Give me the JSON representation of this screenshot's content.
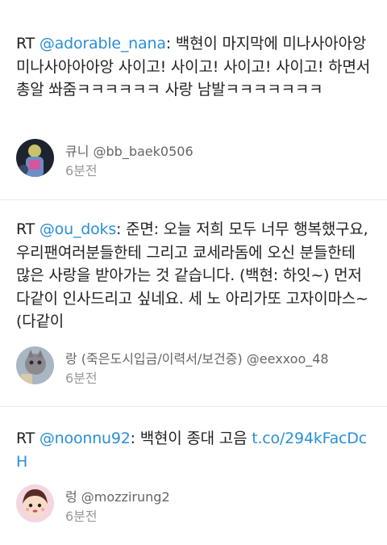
{
  "tweets": [
    {
      "rt_prefix": "RT ",
      "mention": "@adorable_nana",
      "body": ": 백현이 마지막에 미나사아아앙 미나사아아아앙 사이고! 사이고! 사이고! 사이고! 하면서 총알 쏴줌ㅋㅋㅋㅋㅋㅋ 사랑 남발ㅋㅋㅋㅋㅋㅋㅋ",
      "link": "",
      "author": "큐니 @bb_baek0506",
      "time": "6분전",
      "avatar_icon": "user-photo-1"
    },
    {
      "rt_prefix": "RT ",
      "mention": "@ou_doks",
      "body": ": 준면: 오늘 저희 모두 너무 행복했구요, 우리팬여러분들한테 그리고 쿄세라돔에 오신 분들한테 많은 사랑을 받아가는 것 같습니다. (백현: 하잇~) 먼저 다같이 인사드리고 싶네요. 세 노 아리가또 고자이마스~(다같이",
      "link": "",
      "author": "랑 (죽은도시입금/이력서/보건증) @eexxoo_48",
      "time": "6분전",
      "avatar_icon": "user-photo-2"
    },
    {
      "rt_prefix": "RT ",
      "mention": "@noonnu92",
      "body": ": 백현이 종대 고음 ",
      "link": "t.co/294kFacDcH",
      "author": "렁 @mozzirung2",
      "time": "6분전",
      "avatar_icon": "user-photo-3"
    }
  ]
}
